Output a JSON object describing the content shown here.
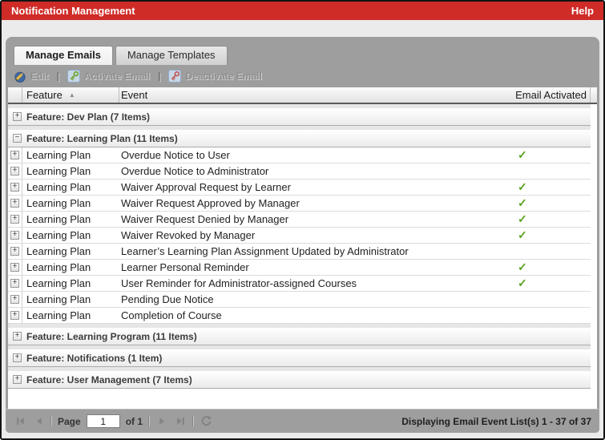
{
  "window": {
    "title": "Notification Management",
    "help_label": "Help"
  },
  "tabs": [
    {
      "label": "Manage Emails",
      "active": true
    },
    {
      "label": "Manage Templates",
      "active": false
    }
  ],
  "toolbar": {
    "separator": "|",
    "buttons": [
      {
        "label": "Edit",
        "icon": "edit-pencil-icon",
        "enabled": false
      },
      {
        "label": "Activate Email",
        "icon": "activate-key-icon",
        "enabled": false
      },
      {
        "label": "Deactivate Email",
        "icon": "deactivate-key-icon",
        "enabled": false
      }
    ]
  },
  "table": {
    "columns": [
      "Feature",
      "Event",
      "Email Activated"
    ],
    "sort_column": "Feature",
    "sort_direction": "ascending",
    "groups": [
      {
        "label": "Feature: Dev Plan (7 Items)",
        "expanded": false,
        "rows": []
      },
      {
        "label": "Feature: Learning Plan (11 Items)",
        "expanded": true,
        "rows": [
          {
            "feature": "Learning Plan",
            "event": "Overdue Notice to User",
            "activated": true
          },
          {
            "feature": "Learning Plan",
            "event": "Overdue Notice to Administrator",
            "activated": false
          },
          {
            "feature": "Learning Plan",
            "event": "Waiver Approval Request by Learner",
            "activated": true
          },
          {
            "feature": "Learning Plan",
            "event": "Waiver Request Approved by Manager",
            "activated": true
          },
          {
            "feature": "Learning Plan",
            "event": "Waiver Request Denied by Manager",
            "activated": true
          },
          {
            "feature": "Learning Plan",
            "event": "Waiver Revoked by Manager",
            "activated": true
          },
          {
            "feature": "Learning Plan",
            "event": "Learner’s Learning Plan Assignment Updated by Administrator",
            "activated": false
          },
          {
            "feature": "Learning Plan",
            "event": "Learner Personal Reminder",
            "activated": true
          },
          {
            "feature": "Learning Plan",
            "event": "User Reminder for Administrator-assigned Courses",
            "activated": true
          },
          {
            "feature": "Learning Plan",
            "event": "Pending Due Notice",
            "activated": false
          },
          {
            "feature": "Learning Plan",
            "event": "Completion of Course",
            "activated": false
          }
        ]
      },
      {
        "label": "Feature: Learning Program (11 Items)",
        "expanded": false,
        "rows": []
      },
      {
        "label": "Feature: Notifications (1 Item)",
        "expanded": false,
        "rows": []
      },
      {
        "label": "Feature: User Management (7 Items)",
        "expanded": false,
        "rows": []
      }
    ]
  },
  "icons": {
    "sort_asc": "▲",
    "check": "✓",
    "collapsed": "+",
    "expanded": "−"
  },
  "footer": {
    "page_label": "Page",
    "page_value": "1",
    "of_label": "of 1",
    "status": "Displaying Email Event List(s) 1 - 37 of 37"
  },
  "colors": {
    "titlebar_red": "#CF2B27",
    "panel_gray": "#9E9E9E",
    "check_green": "#5BA11E"
  }
}
